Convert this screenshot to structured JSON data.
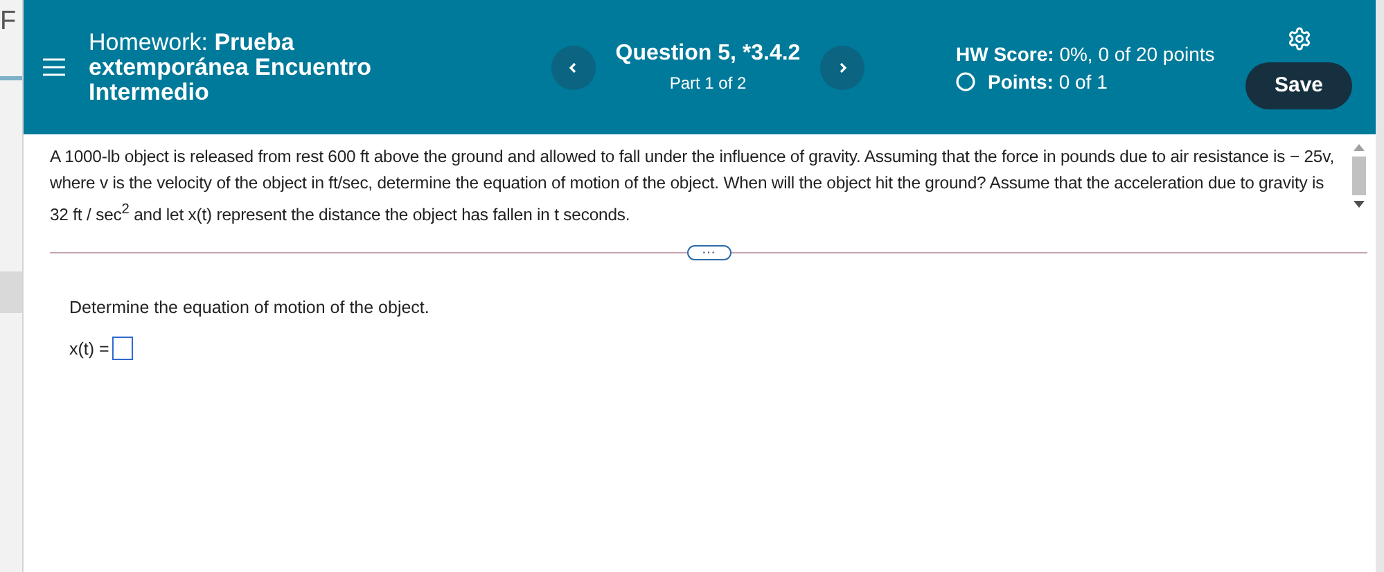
{
  "side_panel": {
    "text": "F"
  },
  "header": {
    "homework_label": "Homework:",
    "homework_title": "Prueba extemporánea Encuentro Intermedio",
    "question": "Question 5, *3.4.2",
    "part": "Part 1 of 2",
    "hw_score_label": "HW Score:",
    "hw_score": "0%, 0 of 20 points",
    "points_label": "Points:",
    "points": "0 of 1",
    "save": "Save"
  },
  "problem": {
    "text": "A 1000-lb object is released from rest 600 ft above the ground and allowed to fall under the influence of gravity. Assuming that the force in pounds due to air resistance is  − 25v, where v is the velocity of the object in ft/sec, determine the equation of motion of the object. When will the object hit the ground? Assume that the acceleration due to gravity is 32 ft / sec$^{2}$ and let x(t) represent the distance the object has fallen in t seconds.",
    "expand": "···"
  },
  "part": {
    "prompt": "Determine the equation of motion of the object.",
    "answer_label": "x(t) ="
  }
}
